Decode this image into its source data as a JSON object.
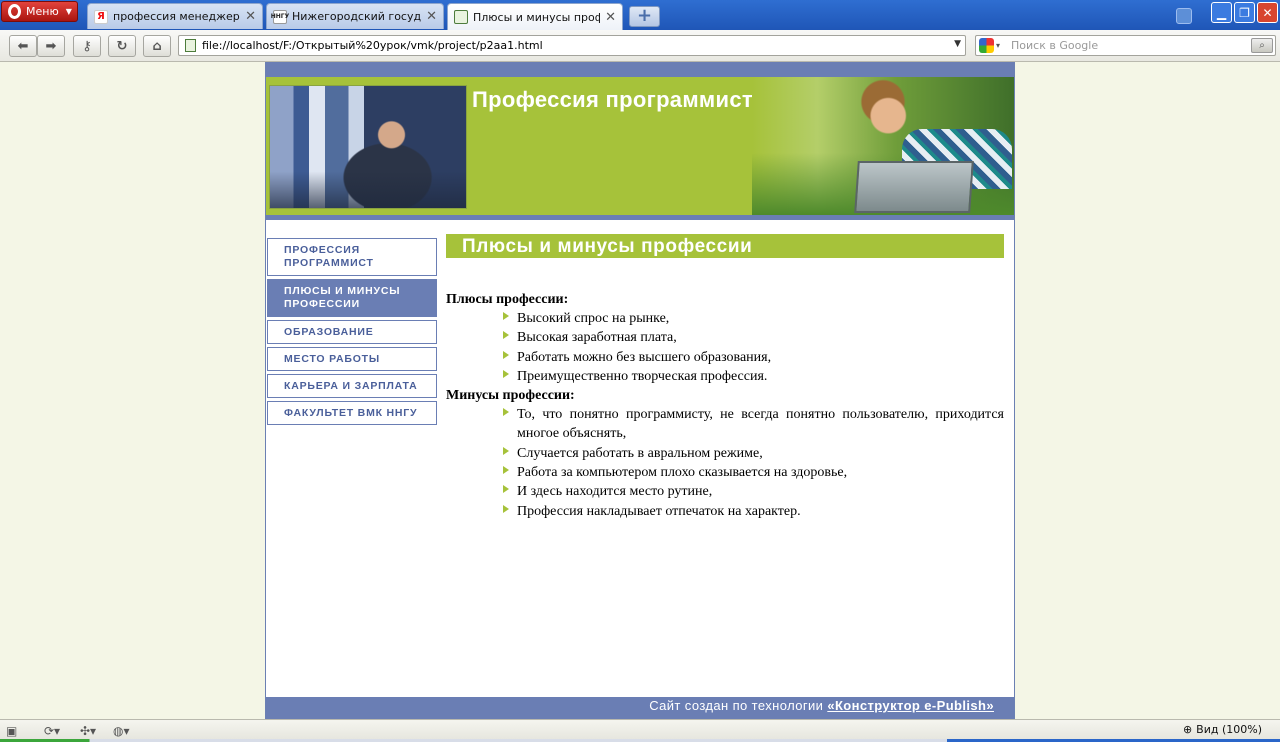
{
  "browser": {
    "menu_label": "Меню",
    "tabs": [
      {
        "title": "профессия менеджер п...",
        "favicon": "Я",
        "active": false
      },
      {
        "title": "Нижегородский госуда...",
        "favicon": "ННГУ",
        "active": false
      },
      {
        "title": "Плюсы и минусы профе...",
        "favicon": "page",
        "active": true
      }
    ],
    "address": "file://localhost/F:/Открытый%20урок/vmk/project/p2aa1.html",
    "search_placeholder": "Поиск в Google",
    "zoom_label": "Вид (100%)"
  },
  "site": {
    "title": "Профессия программист",
    "nav": [
      {
        "label": "ПРОФЕССИЯ ПРОГРАММИСТ",
        "active": false
      },
      {
        "label": "ПЛЮСЫ И МИНУСЫ ПРОФЕССИИ",
        "active": true
      },
      {
        "label": "ОБРАЗОВАНИЕ",
        "active": false
      },
      {
        "label": "МЕСТО РАБОТЫ",
        "active": false
      },
      {
        "label": "КАРЬЕРА И ЗАРПЛАТА",
        "active": false
      },
      {
        "label": "ФАКУЛЬТЕТ ВМК ННГУ",
        "active": false
      }
    ],
    "heading": "Плюсы и минусы профессии",
    "pros_title": "Плюсы профессии:",
    "pros": [
      "Высокий спрос на рынке,",
      "Высокая заработная плата,",
      "Работать можно без высшего образования,",
      "Преимущественно творческая профессия."
    ],
    "cons_title": "Минусы профессии:",
    "cons": [
      "То, что понятно программисту, не всегда понятно пользователю, приходится многое объяснять,",
      "Случается работать в авральном режиме,",
      "Работа за компьютером плохо сказывается на здоровье,",
      "И здесь находится место рутине,",
      "Профессия накладывает отпечаток на характер."
    ],
    "footer_text": "Сайт создан по технологии ",
    "footer_link": "«Конструктор e-Publish»"
  },
  "colors": {
    "accent_green": "#a6c23a",
    "nav_blue": "#6a7eb4",
    "browser_blue": "#1f56b7"
  }
}
